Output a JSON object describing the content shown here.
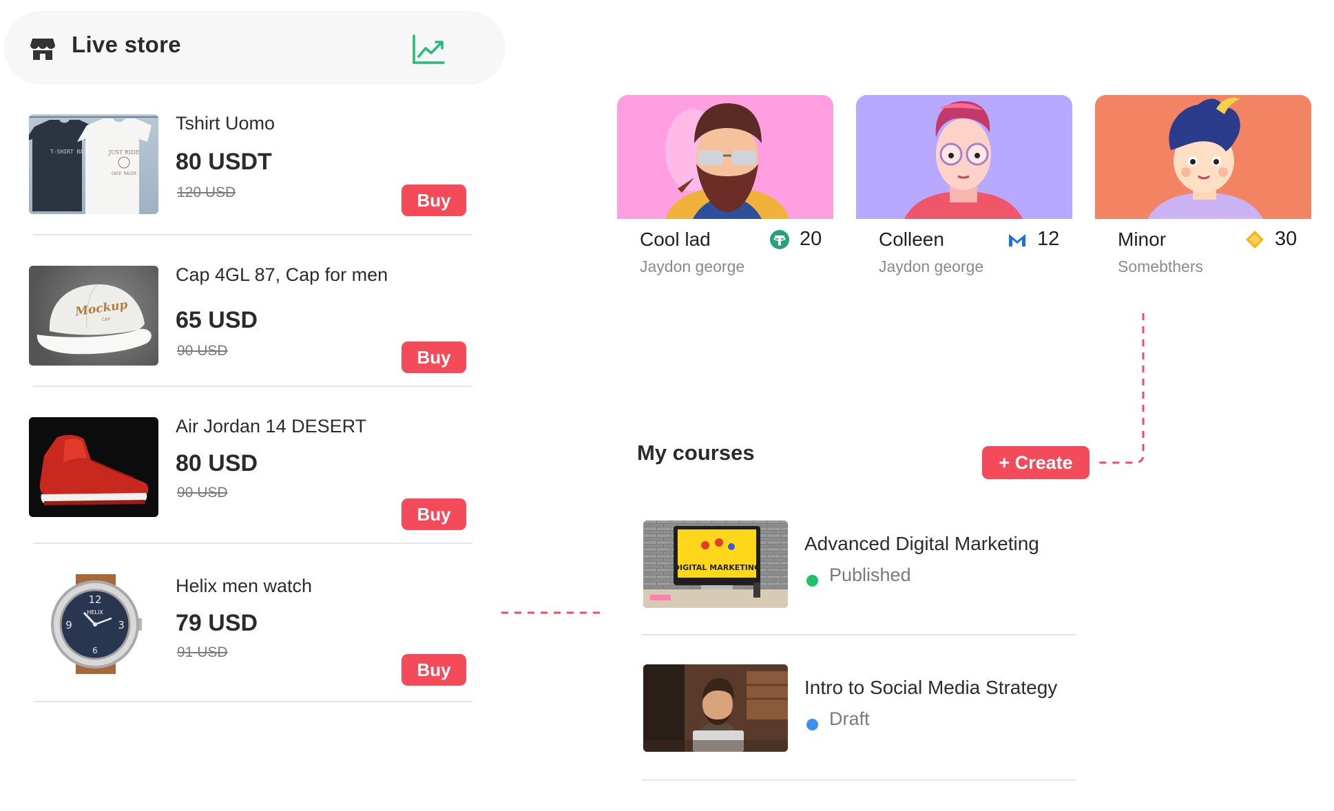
{
  "store": {
    "title": "Live store",
    "icon": "store-icon",
    "chart_icon": "trending-chart-icon"
  },
  "products": [
    {
      "name": "Tshirt Uomo",
      "price": "80 USDT",
      "old_price": "120 USD",
      "buy_label": "Buy"
    },
    {
      "name": "Cap 4GL 87, Cap for men",
      "price": "65 USD",
      "old_price": "90 USD",
      "buy_label": "Buy"
    },
    {
      "name": "Air Jordan 14 DESERT",
      "price": "80 USD",
      "old_price": "90 USD",
      "buy_label": "Buy"
    },
    {
      "name": "Helix men watch",
      "price": "79 USD",
      "old_price": "91 USD",
      "buy_label": "Buy"
    }
  ],
  "product_images": {
    "tshirt": {
      "left_print": "T-SHIRT BA",
      "right_print": "JUST RIDE",
      "right_sub": "CAFE RACER"
    },
    "cap": {
      "print": "Mockup",
      "sub": "CAP"
    },
    "watch": {
      "brand": "HELIX",
      "numerals": [
        "12",
        "3",
        "9",
        "6"
      ]
    }
  },
  "creators": [
    {
      "name": "Cool lad",
      "sub": "Jaydon george",
      "score": "20",
      "token_icon": "tether-coin-icon",
      "bg": "#ff9ee0"
    },
    {
      "name": "Colleen",
      "sub": "Jaydon george",
      "score": "12",
      "token_icon": "m-token-icon",
      "bg": "#b7a9ff"
    },
    {
      "name": "Minor",
      "sub": "Somebthers",
      "score": "30",
      "token_icon": "diamond-token-icon",
      "bg": "#f28463"
    }
  ],
  "courses": {
    "title": "My courses",
    "create_label": "+ Create",
    "items": [
      {
        "title": "Advanced Digital Marketing",
        "status": "Published",
        "status_color": "#1dc26b",
        "thumb_caption": "DIGITAL MARKETING"
      },
      {
        "title": "Intro to Social Media Strategy",
        "status": "Draft",
        "status_color": "#3f8ff0"
      }
    ]
  },
  "colors": {
    "accent": "#f44b5b",
    "chart_green": "#1fbf73",
    "connector": "#f44b5b"
  }
}
